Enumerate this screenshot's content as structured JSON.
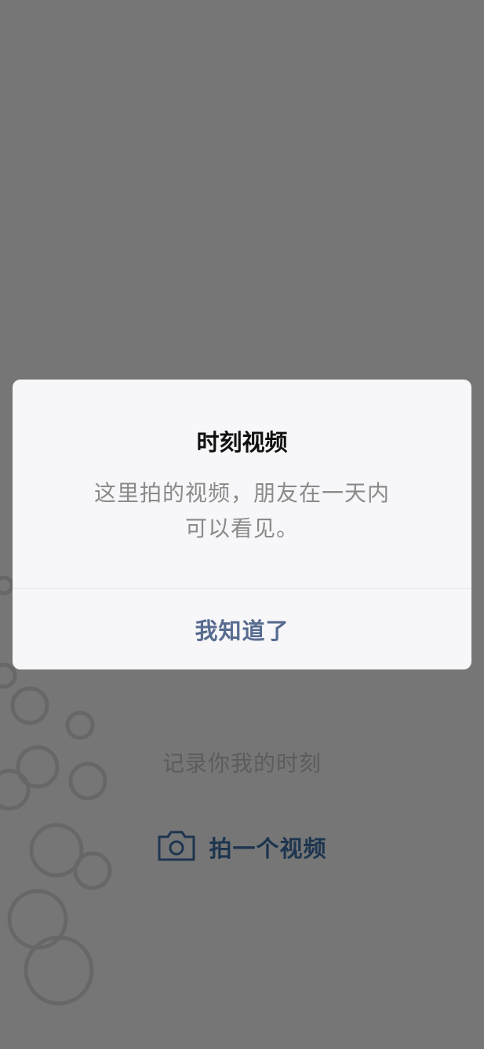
{
  "background": {
    "tagline": "记录你我的时刻",
    "record_button_label": "拍一个视频"
  },
  "dialog": {
    "title": "时刻视频",
    "message_line1": "这里拍的视频，朋友在一天内",
    "message_line2": "可以看见。",
    "confirm_label": "我知道了"
  },
  "colors": {
    "overlay": "#000000",
    "dialog_background": "#f7f7f9",
    "confirm_text": "#586c90",
    "record_accent": "#3b6a9e"
  },
  "icons": {
    "record": "camera-icon"
  }
}
